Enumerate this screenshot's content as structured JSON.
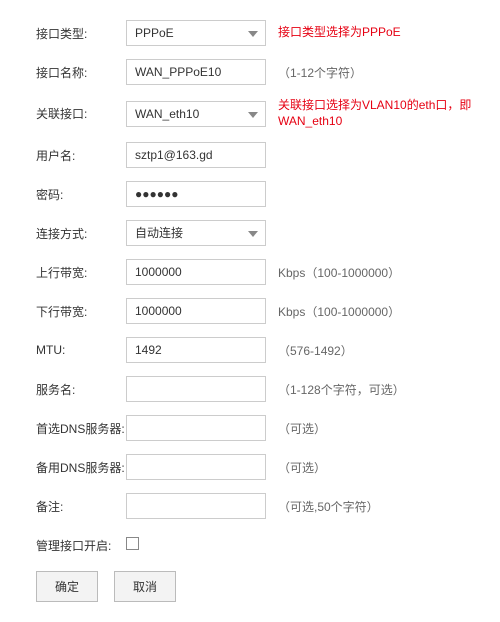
{
  "fields": {
    "interface_type": {
      "label": "接口类型:",
      "value": "PPPoE",
      "annotation": "接口类型选择为PPPoE"
    },
    "interface_name": {
      "label": "接口名称:",
      "value": "WAN_PPPoE10",
      "hint": "（1-12个字符）"
    },
    "assoc_interface": {
      "label": "关联接口:",
      "value": "WAN_eth10",
      "annotation": "关联接口选择为VLAN10的eth口，即WAN_eth10"
    },
    "username": {
      "label": "用户名:",
      "value": "sztp1@163.gd"
    },
    "password": {
      "label": "密码:",
      "value": "●●●●●●"
    },
    "connect_mode": {
      "label": "连接方式:",
      "value": "自动连接"
    },
    "up_bandwidth": {
      "label": "上行带宽:",
      "value": "1000000",
      "hint": "Kbps（100-1000000）"
    },
    "down_bandwidth": {
      "label": "下行带宽:",
      "value": "1000000",
      "hint": "Kbps（100-1000000）"
    },
    "mtu": {
      "label": "MTU:",
      "value": "1492",
      "hint": "（576-1492）"
    },
    "service_name": {
      "label": "服务名:",
      "value": "",
      "hint": "（1-128个字符，可选）"
    },
    "dns1": {
      "label": "首选DNS服务器:",
      "value": "",
      "hint": "（可选）"
    },
    "dns2": {
      "label": "备用DNS服务器:",
      "value": "",
      "hint": "（可选）"
    },
    "remark": {
      "label": "备注:",
      "value": "",
      "hint": "（可选,50个字符）"
    },
    "mgmt_enable": {
      "label": "管理接口开启:"
    }
  },
  "buttons": {
    "ok": "确定",
    "cancel": "取消"
  }
}
